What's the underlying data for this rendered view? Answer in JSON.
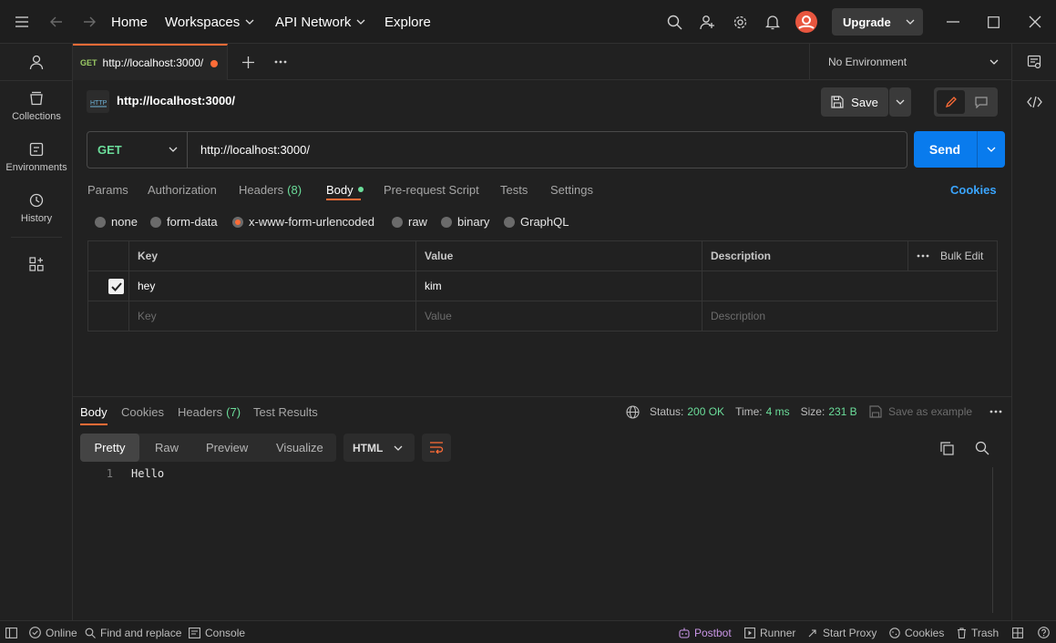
{
  "topbar": {
    "home": "Home",
    "workspaces": "Workspaces",
    "api_network": "API Network",
    "explore": "Explore",
    "upgrade": "Upgrade"
  },
  "sidebar": {
    "items": [
      {
        "label": "Collections",
        "icon": "collections-icon"
      },
      {
        "label": "Environments",
        "icon": "environments-icon"
      },
      {
        "label": "History",
        "icon": "history-icon"
      }
    ]
  },
  "tab": {
    "method": "GET",
    "url": "http://localhost:3000/"
  },
  "environment": {
    "selected": "No Environment"
  },
  "request": {
    "title": "http://localhost:3000/",
    "save_label": "Save",
    "method": "GET",
    "url": "http://localhost:3000/",
    "send_label": "Send",
    "tabs": {
      "params": "Params",
      "authorization": "Authorization",
      "headers": "Headers",
      "headers_count": "(8)",
      "body": "Body",
      "pre_request": "Pre-request Script",
      "tests": "Tests",
      "settings": "Settings",
      "cookies": "Cookies"
    },
    "body_modes": [
      "none",
      "form-data",
      "x-www-form-urlencoded",
      "raw",
      "binary",
      "GraphQL"
    ],
    "body_mode_selected": "x-www-form-urlencoded",
    "table": {
      "headers": {
        "key": "Key",
        "value": "Value",
        "description": "Description",
        "bulk_edit": "Bulk Edit"
      },
      "rows": [
        {
          "key": "hey",
          "value": "kim",
          "description": "",
          "checked": true
        }
      ],
      "placeholders": {
        "key": "Key",
        "value": "Value",
        "description": "Description"
      }
    }
  },
  "response": {
    "tabs": {
      "body": "Body",
      "cookies": "Cookies",
      "headers": "Headers",
      "headers_count": "(7)",
      "test_results": "Test Results"
    },
    "status_label": "Status:",
    "status_value": "200 OK",
    "time_label": "Time:",
    "time_value": "4 ms",
    "size_label": "Size:",
    "size_value": "231 B",
    "save_example": "Save as example",
    "views": [
      "Pretty",
      "Raw",
      "Preview",
      "Visualize"
    ],
    "view_selected": "Pretty",
    "format": "HTML",
    "code_lines": [
      {
        "num": "1",
        "text": "Hello"
      }
    ]
  },
  "statusbar": {
    "online": "Online",
    "find_replace": "Find and replace",
    "console": "Console",
    "postbot": "Postbot",
    "runner": "Runner",
    "start_proxy": "Start Proxy",
    "cookies": "Cookies",
    "trash": "Trash"
  },
  "colors": {
    "accent": "#ff6c37",
    "send": "#097bed",
    "status_ok": "#6bdd9a",
    "link": "#3aa5ff",
    "get_method": "#6bdd9a"
  }
}
